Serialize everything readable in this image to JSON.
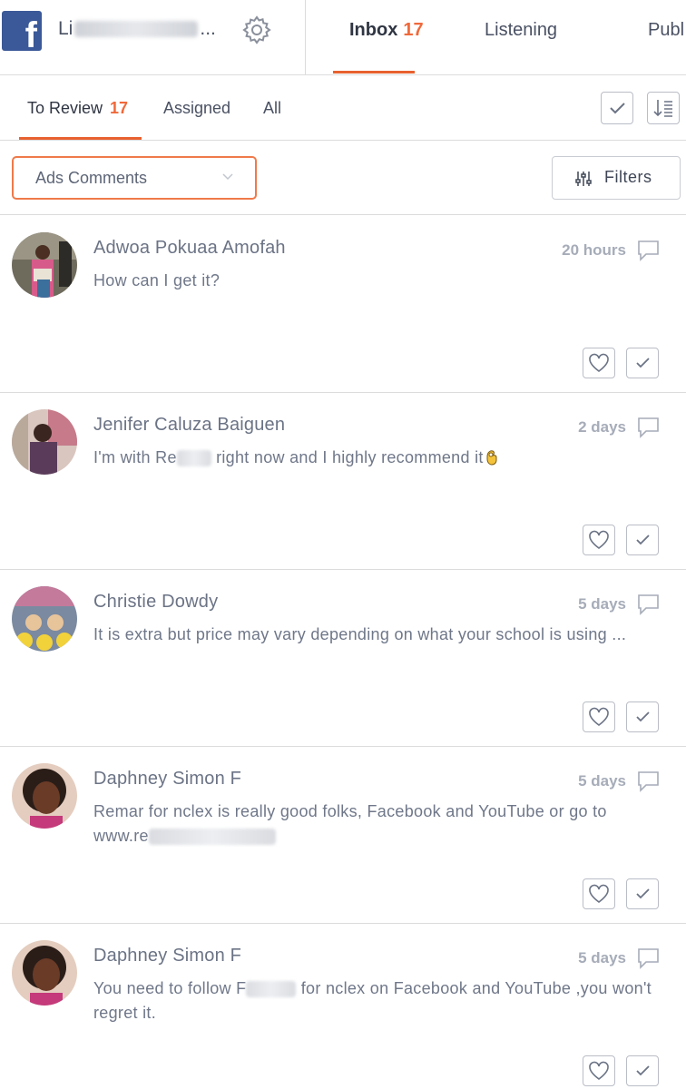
{
  "header": {
    "page_name_prefix": "Li",
    "page_name_suffix": "...",
    "tabs": [
      {
        "label": "Inbox",
        "count": "17"
      },
      {
        "label": "Listening"
      },
      {
        "label": "Publ"
      }
    ]
  },
  "subtabs": [
    {
      "label": "To Review",
      "count": "17"
    },
    {
      "label": "Assigned"
    },
    {
      "label": "All"
    }
  ],
  "filters": {
    "dropdown_value": "Ads Comments",
    "filters_label": "Filters"
  },
  "comments": [
    {
      "author": "Adwoa Pokuaa Amofah",
      "time": "20 hours",
      "text": "How can I get it?"
    },
    {
      "author": "Jenifer Caluza Baiguen",
      "time": "2 days",
      "text_a": "I'm with Re",
      "text_b": " right now and I highly recommend it"
    },
    {
      "author": "Christie Dowdy",
      "time": "5 days",
      "text": "It is extra but price may vary depending on what your school is using ..."
    },
    {
      "author": "Daphney Simon F",
      "time": "5 days",
      "text_a": "Remar for nclex is really good folks, Facebook and YouTube or go to www.re",
      "text_b": ""
    },
    {
      "author": "Daphney Simon F",
      "time": "5 days",
      "text_a": "You need to follow F",
      "text_b": " for nclex on Facebook and YouTube ,you won't regret it."
    }
  ],
  "colors": {
    "accent": "#e8612f",
    "facebook": "#3b5998"
  }
}
